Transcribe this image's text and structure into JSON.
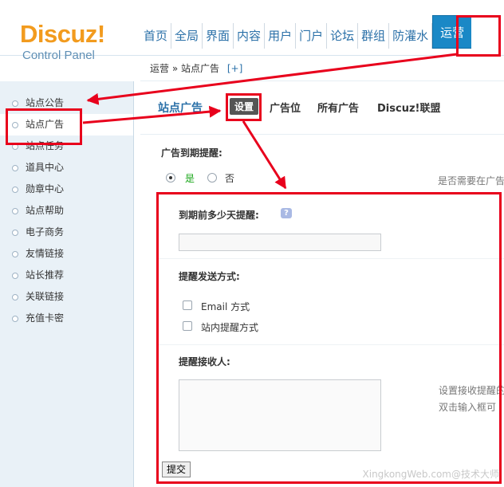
{
  "logo": {
    "brand": "Discuz",
    "bang": "!",
    "subtitle": "Control Panel"
  },
  "topnav": [
    "首页",
    "全局",
    "界面",
    "内容",
    "用户",
    "门户",
    "论坛",
    "群组",
    "防灌水",
    "运营"
  ],
  "breadcrumb": {
    "section": "运营",
    "sep": "»",
    "page": "站点广告",
    "add": "[+]"
  },
  "sidebar": [
    "站点公告",
    "站点广告",
    "站点任务",
    "道具中心",
    "勋章中心",
    "站点帮助",
    "电子商务",
    "友情链接",
    "站长推荐",
    "关联链接",
    "充值卡密"
  ],
  "main": {
    "title": "站点广告",
    "tabs": [
      "设置",
      "广告位",
      "所有广告",
      "Discuz!联盟"
    ],
    "expire_label": "广告到期提醒:",
    "radio_yes": "是",
    "radio_no": "否",
    "expire_tip": "是否需要在广告",
    "days_label": "到期前多少天提醒:",
    "help": "?",
    "method_label": "提醒发送方式:",
    "method_email": "Email 方式",
    "method_site": "站内提醒方式",
    "receiver_label": "提醒接收人:",
    "receiver_tip_1": "设置接收提醒的",
    "receiver_tip_2": "双击输入框可",
    "submit": "提交"
  },
  "watermark": "XingkongWeb.com@技术大师",
  "annotation_color": "#e8001c"
}
